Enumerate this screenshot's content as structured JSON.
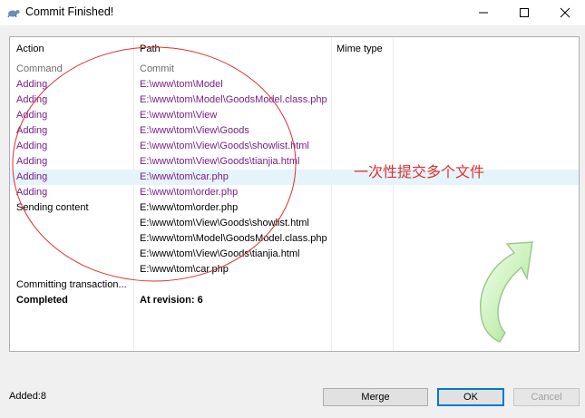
{
  "window": {
    "title": "Commit Finished!"
  },
  "columns": {
    "action": "Action",
    "path": "Path",
    "mime": "Mime type"
  },
  "rows": [
    {
      "action": "Command",
      "path": "Commit",
      "style": "gray"
    },
    {
      "action": "Adding",
      "path": "E:\\www\\tom\\Model",
      "style": "purple"
    },
    {
      "action": "Adding",
      "path": "E:\\www\\tom\\Model\\GoodsModel.class.php",
      "style": "purple"
    },
    {
      "action": "Adding",
      "path": "E:\\www\\tom\\View",
      "style": "purple"
    },
    {
      "action": "Adding",
      "path": "E:\\www\\tom\\View\\Goods",
      "style": "purple"
    },
    {
      "action": "Adding",
      "path": "E:\\www\\tom\\View\\Goods\\showlist.html",
      "style": "purple"
    },
    {
      "action": "Adding",
      "path": "E:\\www\\tom\\View\\Goods\\tianjia.html",
      "style": "purple"
    },
    {
      "action": "Adding",
      "path": "E:\\www\\tom\\car.php",
      "style": "purple",
      "selected": true
    },
    {
      "action": "Adding",
      "path": "E:\\www\\tom\\order.php",
      "style": "purple"
    },
    {
      "action": "Sending content",
      "path": "E:\\www\\tom\\order.php",
      "style": "black"
    },
    {
      "action": "",
      "path": "E:\\www\\tom\\View\\Goods\\showlist.html",
      "style": "black"
    },
    {
      "action": "",
      "path": "E:\\www\\tom\\Model\\GoodsModel.class.php",
      "style": "black"
    },
    {
      "action": "",
      "path": "E:\\www\\tom\\View\\Goods\\tianjia.html",
      "style": "black"
    },
    {
      "action": "",
      "path": "E:\\www\\tom\\car.php",
      "style": "black"
    },
    {
      "action": "Committing transaction...",
      "path": "",
      "style": "black"
    },
    {
      "action": "Completed",
      "path": "At revision: 6",
      "style": "bold"
    }
  ],
  "annotation": {
    "text": "一次性提交多个文件",
    "color": "#e03030"
  },
  "status": {
    "added": "Added:8"
  },
  "buttons": {
    "merge": "Merge",
    "ok": "OK",
    "cancel": "Cancel"
  },
  "colors": {
    "purple": "#7a1f8a",
    "gray": "#6d6d6d",
    "selection": "#e5f3fb",
    "accent": "#0078d7",
    "annotation": "#e03030"
  }
}
